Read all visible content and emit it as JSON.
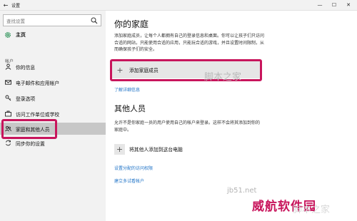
{
  "window": {
    "back_glyph": "←",
    "title": "设置",
    "controls": [
      "—",
      "☐",
      "✕"
    ]
  },
  "sidebar": {
    "search_placeholder": "查找设置",
    "home_label": "主页",
    "section_label": "帐户",
    "items": [
      {
        "label": "你的信息",
        "icon": "person-icon"
      },
      {
        "label": "电子邮件和应用帐户",
        "icon": "email-icon"
      },
      {
        "label": "登录选项",
        "icon": "key-icon"
      },
      {
        "label": "访问工作单位或学校",
        "icon": "briefcase-icon"
      },
      {
        "label": "家庭和其他人员",
        "icon": "people-icon",
        "selected": true
      },
      {
        "label": "同步你的设置",
        "icon": "sync-icon"
      }
    ]
  },
  "main": {
    "family": {
      "heading": "你的家庭",
      "description": "添加家庭成员，让每个人都拥有自己的登录信息和桌面。你可以让孩子们只访问合适的网站，只能使用合适的应用，只能玩合适的游戏，并且设置时间限制，从而确保孩子们的安全。",
      "add_button": "添加家庭成员",
      "learn_more": "了解详细信息"
    },
    "others": {
      "heading": "其他人员",
      "description": "允许不是你家庭一员的用户使用自己的帐户来登录。这样不会将其添加到你的家庭中。",
      "add_button": "将其他人添加到这台电脑",
      "assigned_access": "设置分配的访问权限",
      "kiosk": "建立多试看帐户"
    }
  },
  "watermarks": {
    "top": "脚本之家",
    "url": "jb51.net",
    "brand": "威航软件园",
    "bottom": "脚本之家"
  },
  "colors": {
    "highlight_border": "#c8155c",
    "link": "#1f73c7",
    "sidebar_bg": "#f2f2f2",
    "selected_bg": "#c7c7c7"
  }
}
